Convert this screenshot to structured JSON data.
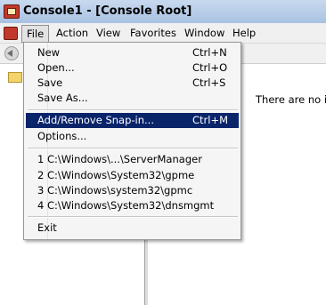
{
  "window": {
    "title": "Console1 - [Console Root]"
  },
  "menubar": {
    "items": [
      "File",
      "Action",
      "View",
      "Favorites",
      "Window",
      "Help"
    ]
  },
  "file_menu": {
    "items": [
      {
        "label": "New",
        "shortcut": "Ctrl+N"
      },
      {
        "label": "Open...",
        "shortcut": "Ctrl+O"
      },
      {
        "label": "Save",
        "shortcut": "Ctrl+S"
      },
      {
        "label": "Save As...",
        "shortcut": ""
      },
      {
        "label": "Add/Remove Snap-in...",
        "shortcut": "Ctrl+M"
      },
      {
        "label": "Options...",
        "shortcut": ""
      },
      {
        "label": "1 C:\\Windows\\...\\ServerManager",
        "shortcut": ""
      },
      {
        "label": "2 C:\\Windows\\System32\\gpme",
        "shortcut": ""
      },
      {
        "label": "3 C:\\Windows\\system32\\gpmc",
        "shortcut": ""
      },
      {
        "label": "4 C:\\Windows\\System32\\dnsmgmt",
        "shortcut": ""
      },
      {
        "label": "Exit",
        "shortcut": ""
      }
    ],
    "highlighted": "Add/Remove Snap-in..."
  },
  "result_pane": {
    "empty_text": "There are no ite"
  },
  "icons": {
    "app": "mmc-console-icon",
    "back": "back-arrow-icon",
    "tree_root": "folder-icon"
  },
  "colors": {
    "highlight": "#0a246a",
    "titlebar": "#b9cfe9"
  }
}
